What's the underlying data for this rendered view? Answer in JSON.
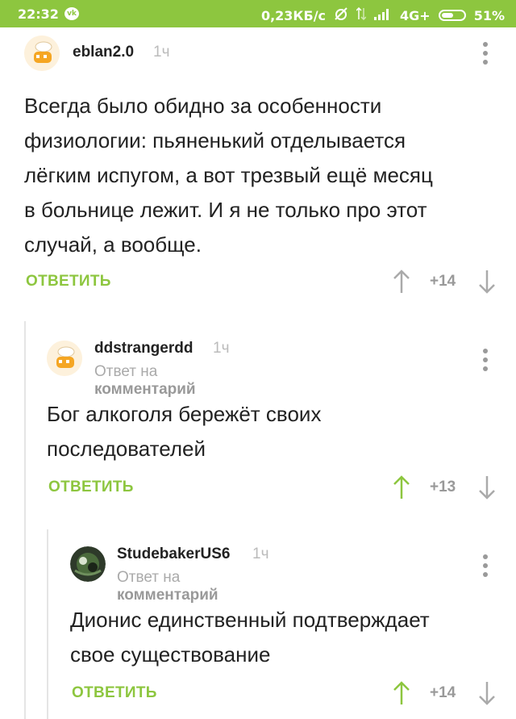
{
  "status_bar": {
    "time": "22:32",
    "network_speed": "0,23КБ/с",
    "network_type": "4G+",
    "battery": "51%"
  },
  "comments": [
    {
      "author": "eblan2.0",
      "time": "1ч",
      "reply_to": null,
      "text_lines": [
        "Всегда было обидно за особенности",
        "физиологии: пьяненький отделывается",
        "лёгким испугом, а вот трезвый ещё месяц",
        "в больнице лежит. И я не только про этот",
        "случай, а вообще."
      ],
      "reply_label": "ОТВЕТИТЬ",
      "score": "+14",
      "upvoted": false
    },
    {
      "author": "ddstrangerdd",
      "time": "1ч",
      "reply_to": {
        "prefix": "Ответ на",
        "link": "комментарий"
      },
      "text_lines": [
        "Бог алкоголя бережёт своих",
        "последователей"
      ],
      "reply_label": "ОТВЕТИТЬ",
      "score": "+13",
      "upvoted": true
    },
    {
      "author": "StudebakerUS6",
      "time": "1ч",
      "reply_to": {
        "prefix": "Ответ на",
        "link": "комментарий"
      },
      "text_lines": [
        "Дионис единственный подтверждает",
        "свое существование"
      ],
      "reply_label": "ОТВЕТИТЬ",
      "score": "+14",
      "upvoted": true
    }
  ],
  "colors": {
    "accent": "#8dc63f",
    "text": "#222222",
    "muted": "#aaaaaa"
  }
}
